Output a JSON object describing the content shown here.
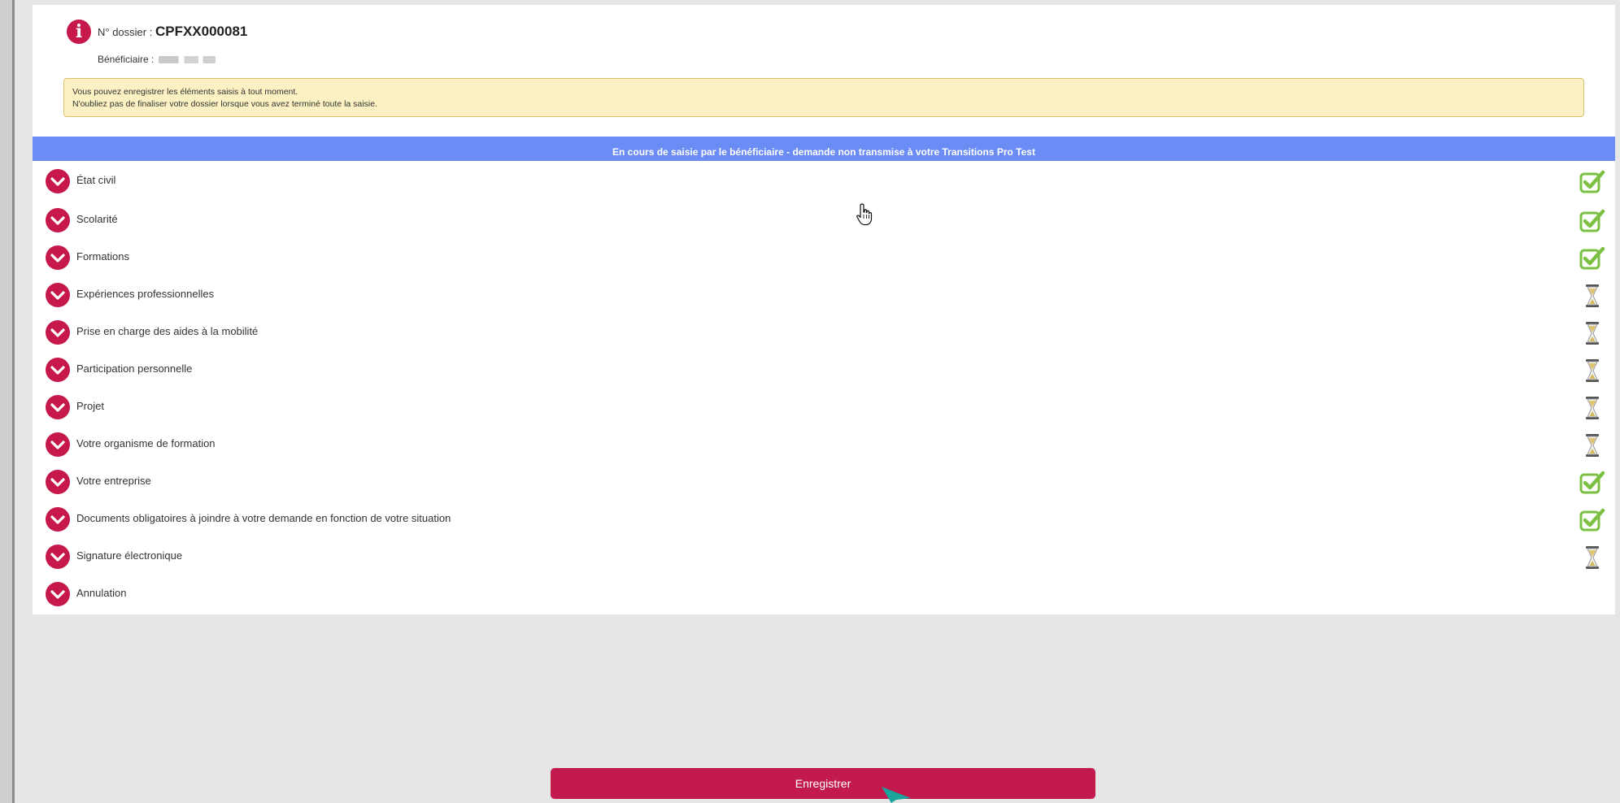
{
  "header": {
    "dossier_label": "N° dossier :",
    "dossier_number": "CPFXX000081",
    "beneficiary_label": "Bénéficiaire :"
  },
  "notice": {
    "line1": "Vous pouvez enregistrer les éléments saisis à tout moment.",
    "line2": "N'oubliez pas de finaliser votre dossier lorsque vous avez terminé toute la saisie."
  },
  "status_bar": "En cours de saisie par le bénéficiaire - demande non transmise à votre Transitions Pro Test",
  "sections": [
    {
      "label": "État civil",
      "status": "complete"
    },
    {
      "label": "Scolarité",
      "status": "complete"
    },
    {
      "label": "Formations",
      "status": "complete"
    },
    {
      "label": "Expériences professionnelles",
      "status": "pending"
    },
    {
      "label": "Prise en charge des aides à la mobilité",
      "status": "pending"
    },
    {
      "label": "Participation personnelle",
      "status": "pending"
    },
    {
      "label": "Projet",
      "status": "pending"
    },
    {
      "label": "Votre organisme de formation",
      "status": "pending"
    },
    {
      "label": "Votre entreprise",
      "status": "complete"
    },
    {
      "label": "Documents obligatoires à joindre à votre demande en fonction de votre situation",
      "status": "complete"
    },
    {
      "label": "Signature électronique",
      "status": "pending"
    },
    {
      "label": "Annulation",
      "status": "none"
    }
  ],
  "save_button": "Enregistrer",
  "colors": {
    "accent": "#c6184a",
    "status_bar": "#6c8cf5",
    "notice_bg": "#fbf1c2",
    "check": "#7bc043"
  },
  "icons": {
    "info": "info-icon",
    "expand": "chevron-down-icon",
    "complete": "check-icon",
    "pending": "hourglass-icon"
  }
}
